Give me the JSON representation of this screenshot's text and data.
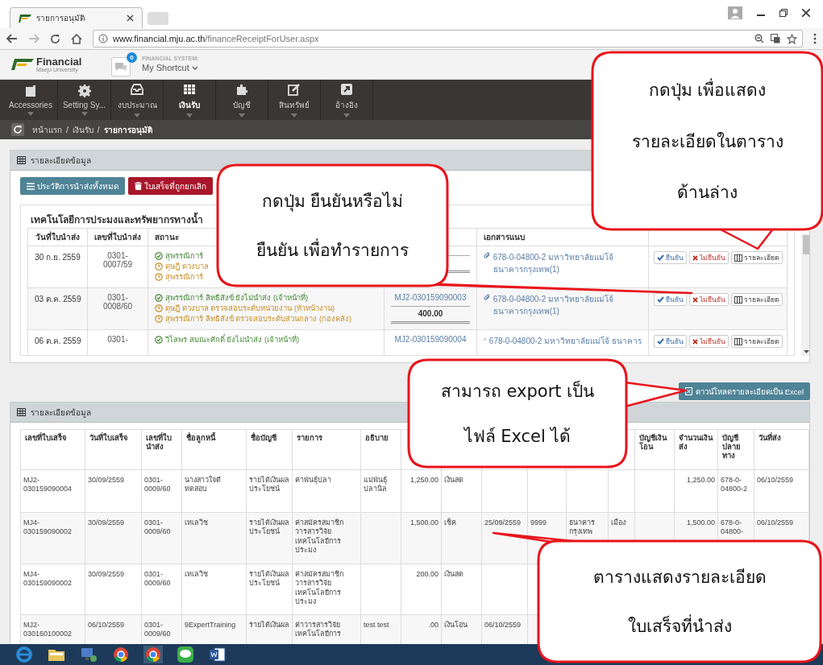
{
  "browser": {
    "tab_title": "รายการอนุมัติ",
    "url_host": "www.financial.mju.ac.th",
    "url_path": "/financeReceiptForUser.aspx"
  },
  "header": {
    "logo": "Financial",
    "logo_sub": "Maejo University",
    "badge": "0",
    "system_label": "FINANCIAL SYSTEM:",
    "shortcut": "My Shortcut"
  },
  "nav": [
    {
      "label": "Accessories",
      "selected": false
    },
    {
      "label": "Setting Sy...",
      "selected": false
    },
    {
      "label": "งบประมาณ",
      "selected": false
    },
    {
      "label": "เงินรับ",
      "selected": true
    },
    {
      "label": "บัญชี",
      "selected": false
    },
    {
      "label": "สินทรัพย์",
      "selected": false
    },
    {
      "label": "อ้างอิง",
      "selected": false
    }
  ],
  "breadcrumb": [
    {
      "kind": "link",
      "text": "หน้าแรก"
    },
    {
      "kind": "sep",
      "text": "/"
    },
    {
      "kind": "link",
      "text": "เงินรับ"
    },
    {
      "kind": "sep",
      "text": "/"
    },
    {
      "kind": "current",
      "text": "รายการอนุมัติ"
    }
  ],
  "panel_top": {
    "title": "รายละเอียดข้อมูล",
    "buttons": [
      {
        "label": "ประวัติการนำส่งทั้งหมด",
        "kind": "info"
      },
      {
        "label": "ใบเสร็จที่ถูกยกเลิก",
        "kind": "danger"
      }
    ],
    "card_title": "เทคโนโลยีการประมงและทรัพยากรทางน้ำ",
    "columns": {
      "date": "วันที่ใบนำส่ง",
      "number": "เลขที่ใบนำส่ง",
      "status": "สถานะ",
      "attachment": "เอกสารแนบ"
    },
    "rows": [
      {
        "date": "30 ก.ย. 2559",
        "number": "0301-0007/59",
        "statuses": [
          {
            "kind": "done",
            "text": "สุพรรณิการ์"
          },
          {
            "kind": "pending",
            "text": "ดุษฎี ดวงบาล"
          },
          {
            "kind": "pending",
            "text": "สุพรรณิการ์"
          }
        ],
        "receipts": [],
        "attachment": "678-0-04800-2 มหาวิทยาลัยแม่โจ้ ธนาคารกรุงเทพ(1)",
        "actions": [
          {
            "label": "ยืนยัน",
            "kind": "confirm"
          },
          {
            "label": "ไม่ยืนยัน",
            "kind": "reject"
          },
          {
            "label": "รายละเอียด",
            "kind": "detail"
          }
        ]
      },
      {
        "date": "03 ต.ค. 2559",
        "number": "0301-0008/60",
        "statuses": [
          {
            "kind": "done",
            "text": "สุพรรณิการ์ ลิทธิสังข์ ยังไม่นำส่ง (เจ้าหน้าที่)"
          },
          {
            "kind": "pending",
            "text": "ดุษฎี ดวงบาล ตรวจสอบระดับหน่วยงาน (หัวหน้างาน)"
          },
          {
            "kind": "pending",
            "text": "สุพรรณิการ์ ลิทธิสังข์ ตรวจสอบระดับส่วนกลาง (กองคลัง)"
          }
        ],
        "receipts": [
          "MJ2-030159090003"
        ],
        "amount": "400.00",
        "attachment": "678-0-04800-2 มหาวิทยาลัยแม่โจ้ ธนาคารกรุงเทพ(1)",
        "actions": [
          {
            "label": "ยืนยัน",
            "kind": "confirm"
          },
          {
            "label": "ไม่ยืนยัน",
            "kind": "reject"
          },
          {
            "label": "รายละเอียด",
            "kind": "detail"
          }
        ]
      },
      {
        "date": "06 ต.ค. 2559",
        "number": "0301-",
        "statuses": [
          {
            "kind": "done",
            "text": "วิไลพร สมณะศักดิ์ ยังไม่นำส่ง (เจ้าหน้าที่)"
          }
        ],
        "receipts": [
          "MJ2-030159090004"
        ],
        "attachment": "678-0-04800-2 มหาวิทยาลัยแม่โจ้ ธนาคาร",
        "actions": [
          {
            "label": "ยืนยัน",
            "kind": "confirm"
          },
          {
            "label": "ไม่ยืนยัน",
            "kind": "reject"
          },
          {
            "label": "รายละเอียด",
            "kind": "detail"
          }
        ]
      }
    ]
  },
  "export_button": "ดาวน์โหลดรายละเอียดเป็น Excel",
  "panel_bottom": {
    "title": "รายละเอียดข้อมูล",
    "columns": [
      {
        "label": "เลขที่ใบเสร็จ"
      },
      {
        "label": "วันที่ใบเสร็จ"
      },
      {
        "label": "เลขที่ใบนำส่ง"
      },
      {
        "label": "ชื่อลูกหนี้"
      },
      {
        "label": "ชื่อบัญชี"
      },
      {
        "label": "รายการ"
      },
      {
        "label": "อธิบาย"
      },
      {},
      {},
      {},
      {},
      {},
      {},
      {
        "label": "บัญชีเงินโอน"
      },
      {
        "label": "จำนวนเงินส่ง"
      },
      {
        "label": "บัญชีปลายทาง"
      },
      {
        "label": "วันที่ส่ง"
      }
    ],
    "rows": [
      [
        "MJ2-030159090004",
        "30/09/2559",
        "0301-0009/60",
        "นางสาวใจดี ทดสอบ",
        "รายได้เงินผลประโยชน์",
        "ค่าพันธุ์ปลา",
        "แม่พันธุ์ปลานิล",
        "1,250.00",
        "เงินสด",
        null,
        null,
        null,
        null,
        null,
        "1,250.00",
        "678-0-04800-2",
        "06/10/2559"
      ],
      [
        "MJ4-030159090002",
        "30/09/2559",
        "0301-0009/60",
        "เทเลวิช",
        "รายได้เงินผลประโยชน์",
        "ค่าสมัครสมาชิกวารสารวิจัยเทคโนโลยีการประมง",
        null,
        "1,500.00",
        "เช็ค",
        "25/09/2559",
        "9999",
        "ธนาคารกรุงเทพ",
        "เมือง",
        null,
        "1,500.00",
        "678-0-04800-",
        "06/10/2559"
      ],
      [
        "MJ4-030159090002",
        "30/09/2559",
        "0301-0009/60",
        "เทเลวิช",
        "รายได้เงินผลประโยชน์",
        "ค่าสมัครสมาชิกวารสารวิจัยเทคโนโลยีการประมง",
        null,
        "200.00",
        "เงินสด",
        null,
        null,
        null,
        null,
        null,
        null,
        null,
        null
      ],
      [
        "MJ2-030160100002",
        "06/10/2559",
        "0301-0009/60",
        "9ExpertTraining",
        "รายได้เงินผล",
        "ค่าวารสารวิจัยเทคโนโลยีการ",
        "test test",
        ".00",
        "เงินโอน",
        "06/10/2559",
        null,
        null,
        null,
        null,
        null,
        null,
        null
      ]
    ]
  },
  "callouts": [
    {
      "lines": [
        "กดปุ่ม เพื่อแสดง",
        "รายละเอียดในตาราง",
        "ด้านล่าง"
      ]
    },
    {
      "lines": [
        "กดปุ่ม ยืนยันหรือไม่",
        "ยืนยัน เพื่อทำรายการ"
      ]
    },
    {
      "lines": [
        "สามารถ export เป็น",
        "ไฟล์ Excel ได้"
      ]
    },
    {
      "lines": [
        "ตารางแสดงรายละเอียด",
        "ใบเสร็จที่นำส่ง"
      ]
    }
  ]
}
